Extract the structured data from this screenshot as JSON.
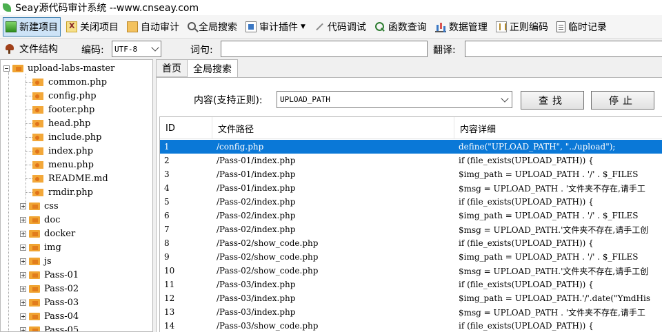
{
  "window": {
    "title": "Seay源代码审计系统 --www.cnseay.com"
  },
  "toolbar": {
    "items": [
      {
        "label": "新建项目",
        "icon": "new-project-icon"
      },
      {
        "label": "关闭项目",
        "icon": "close-project-icon"
      },
      {
        "label": "自动审计",
        "icon": "auto-audit-icon"
      },
      {
        "label": "全局搜索",
        "icon": "global-search-icon"
      },
      {
        "label": "审计插件",
        "icon": "plugin-icon"
      },
      {
        "label": "代码调试",
        "icon": "debug-icon"
      },
      {
        "label": "函数查询",
        "icon": "function-query-icon"
      },
      {
        "label": "数据管理",
        "icon": "data-manage-icon"
      },
      {
        "label": "正则编码",
        "icon": "regex-encode-icon"
      },
      {
        "label": "临时记录",
        "icon": "temp-note-icon"
      }
    ]
  },
  "options": {
    "file_structure_label": "文件结构",
    "encoding_label": "编码:",
    "encoding_value": "UTF-8",
    "word_label": "词句:",
    "word_value": "",
    "translate_label": "翻译:",
    "translate_value": ""
  },
  "tree": {
    "root": "upload-labs-master",
    "files": [
      "common.php",
      "config.php",
      "footer.php",
      "head.php",
      "include.php",
      "index.php",
      "menu.php",
      "README.md",
      "rmdir.php"
    ],
    "folders": [
      "css",
      "doc",
      "docker",
      "img",
      "js",
      "Pass-01",
      "Pass-02",
      "Pass-03",
      "Pass-04",
      "Pass-05"
    ]
  },
  "tabs": [
    {
      "label": "首页"
    },
    {
      "label": "全局搜索"
    }
  ],
  "search": {
    "label": "内容(支持正则):",
    "value": "UPLOAD_PATH",
    "find_button": "查找",
    "stop_button": "停止"
  },
  "results": {
    "columns": [
      "ID",
      "文件路径",
      "内容详细"
    ],
    "selected_index": 0,
    "rows": [
      {
        "id": "1",
        "path": "/config.php",
        "detail": "define(\"UPLOAD_PATH\", \"../upload\");"
      },
      {
        "id": "2",
        "path": "/Pass-01/index.php",
        "detail": "if (file_exists(UPLOAD_PATH)) {"
      },
      {
        "id": "3",
        "path": "/Pass-01/index.php",
        "detail": "$img_path = UPLOAD_PATH . '/' . $_FILES"
      },
      {
        "id": "4",
        "path": "/Pass-01/index.php",
        "detail": "$msg = UPLOAD_PATH . '文件夹不存在,请手工"
      },
      {
        "id": "5",
        "path": "/Pass-02/index.php",
        "detail": "if (file_exists(UPLOAD_PATH)) {"
      },
      {
        "id": "6",
        "path": "/Pass-02/index.php",
        "detail": "$img_path = UPLOAD_PATH . '/' . $_FILES"
      },
      {
        "id": "7",
        "path": "/Pass-02/index.php",
        "detail": "$msg = UPLOAD_PATH.'文件夹不存在,请手工创"
      },
      {
        "id": "8",
        "path": "/Pass-02/show_code.php",
        "detail": "if (file_exists(UPLOAD_PATH)) {"
      },
      {
        "id": "9",
        "path": "/Pass-02/show_code.php",
        "detail": "$img_path = UPLOAD_PATH . '/' . $_FILES"
      },
      {
        "id": "10",
        "path": "/Pass-02/show_code.php",
        "detail": "$msg = UPLOAD_PATH.'文件夹不存在,请手工创"
      },
      {
        "id": "11",
        "path": "/Pass-03/index.php",
        "detail": "if (file_exists(UPLOAD_PATH)) {"
      },
      {
        "id": "12",
        "path": "/Pass-03/index.php",
        "detail": "$img_path = UPLOAD_PATH.'/'.date(\"YmdHis"
      },
      {
        "id": "13",
        "path": "/Pass-03/index.php",
        "detail": "$msg = UPLOAD_PATH . '文件夹不存在,请手工"
      },
      {
        "id": "14",
        "path": "/Pass-03/show_code.php",
        "detail": "if (file_exists(UPLOAD_PATH)) {"
      }
    ]
  }
}
